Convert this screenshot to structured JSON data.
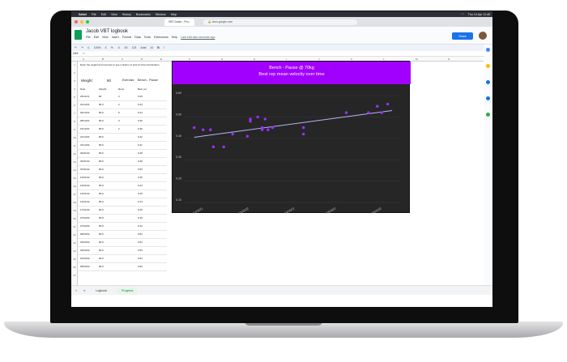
{
  "macos": {
    "app": "Safari",
    "menus": [
      "File",
      "Edit",
      "View",
      "History",
      "Bookmarks",
      "Window",
      "Help"
    ],
    "clock": "Thu 14 Apr 11:45"
  },
  "browser": {
    "tab_title": "VBT Dutch - Pro...",
    "url": "docs.google.com"
  },
  "doc": {
    "title": "Jacob VBT logbook",
    "menus": [
      "File",
      "Edit",
      "View",
      "Insert",
      "Format",
      "Data",
      "Tools",
      "Extensions",
      "Help"
    ],
    "last_edit": "Last edit was seconds ago",
    "share_label": "Share"
  },
  "toolbar": {
    "zoom": "100%",
    "format_items": [
      "£",
      "%",
      ".0",
      ".00",
      "123"
    ],
    "font": "Arial",
    "font_size": "10"
  },
  "formula_bar": {
    "cell_ref": "N48",
    "fx": "fx"
  },
  "columns": [
    "A",
    "B",
    "C",
    "D",
    "E",
    "F",
    "G",
    "H",
    "I",
    "J",
    "K",
    "L",
    "M",
    "N"
  ],
  "rows": [
    "1",
    "2",
    "3",
    "4",
    "5",
    "6",
    "7",
    "8",
    "9",
    "10",
    "11",
    "12",
    "13",
    "14",
    "15",
    "16",
    "17",
    "18",
    "19",
    "20",
    "21",
    "22",
    "23",
    "24",
    "25",
    "26",
    "27"
  ],
  "sheet": {
    "instruction": "Enter the weight and exercise to see a history of sets for that combination",
    "weight_label": "Weight:",
    "weight_value": "80",
    "exercise_label": "Exercise",
    "exercise_value": "Bench - Pause",
    "headers": [
      "Date",
      "Weight",
      "Reps",
      "Best vel"
    ],
    "table": [
      [
        "25/11/21",
        "80",
        "3",
        "0.45"
      ],
      [
        "01/12/21",
        "80.0",
        "2",
        "0.44"
      ],
      [
        "06/12/21",
        "80.0",
        "6",
        "0.44"
      ],
      [
        "08/12/21",
        "80.0",
        "3",
        "0.36"
      ],
      [
        "15/12/21",
        "80.0",
        "2",
        "0.36"
      ],
      [
        "21/12/21",
        "80.0",
        "",
        "0.42"
      ],
      [
        "31/12/21",
        "80.0",
        "",
        "0.41"
      ],
      [
        "02/01/22",
        "80.0",
        "",
        "0.48"
      ],
      [
        "02/01/22",
        "80.0",
        "",
        "0.49"
      ],
      [
        "07/01/22",
        "80.0",
        "",
        "0.50"
      ],
      [
        "10/01/22",
        "80.0",
        "",
        "0.45"
      ],
      [
        "10/01/22",
        "80.0",
        "",
        "0.44"
      ],
      [
        "12/01/22",
        "80.0",
        "",
        "0.49"
      ],
      [
        "14/01/22",
        "80.0",
        "",
        "0.44"
      ],
      [
        "17/01/22",
        "80.0",
        "",
        "0.45"
      ],
      [
        "07/02/22",
        "80.0",
        "",
        "0.45"
      ],
      [
        "07/02/22",
        "80.0",
        "",
        "0.42"
      ],
      [
        "08/03/22",
        "80.0",
        "",
        "0.52"
      ],
      [
        "23/03/22",
        "80.0",
        "",
        "0.52"
      ],
      [
        "29/03/22",
        "80.0",
        "",
        "0.55"
      ],
      [
        "01/04/22",
        "80.0",
        "",
        "0.52"
      ],
      [
        "05/04/22",
        "80.0",
        "",
        "0.56"
      ]
    ]
  },
  "chart_data": {
    "type": "scatter",
    "title": "Bench - Pause @ 70kg",
    "subtitle": "Best rep mean velocity over time",
    "colors": {
      "header": "#a100ff",
      "points": "#9b30ff",
      "trend": "#b8b4ff",
      "background": "#262626"
    },
    "yticks": [
      "0.60",
      "0.50",
      "0.40",
      "0.30",
      "0.20",
      "0.10"
    ],
    "ylim": [
      0.1,
      0.6
    ],
    "xticks": [
      "01/12/2021",
      "01/01/2022",
      "01/02/2022",
      "01/03/2022",
      "01/04/2022"
    ],
    "xlim": [
      "2021-11-18",
      "2022-04-14"
    ],
    "series": [
      {
        "points": [
          [
            "2021-11-25",
            0.45
          ],
          [
            "2021-12-01",
            0.44
          ],
          [
            "2021-12-06",
            0.44
          ],
          [
            "2021-12-08",
            0.36
          ],
          [
            "2021-12-15",
            0.36
          ],
          [
            "2021-12-21",
            0.42
          ],
          [
            "2021-12-31",
            0.41
          ],
          [
            "2022-01-02",
            0.48
          ],
          [
            "2022-01-02",
            0.49
          ],
          [
            "2022-01-07",
            0.5
          ],
          [
            "2022-01-10",
            0.45
          ],
          [
            "2022-01-10",
            0.44
          ],
          [
            "2022-01-12",
            0.49
          ],
          [
            "2022-01-14",
            0.44
          ],
          [
            "2022-01-17",
            0.45
          ],
          [
            "2022-02-07",
            0.45
          ],
          [
            "2022-02-07",
            0.42
          ],
          [
            "2022-03-08",
            0.52
          ],
          [
            "2022-03-23",
            0.52
          ],
          [
            "2022-03-29",
            0.55
          ],
          [
            "2022-04-01",
            0.52
          ],
          [
            "2022-04-05",
            0.56
          ]
        ]
      }
    ],
    "trendline": [
      [
        "2021-11-25",
        0.405
      ],
      [
        "2022-04-08",
        0.53
      ]
    ]
  },
  "sheet_tabs": {
    "add": "+",
    "all": "≡",
    "tabs": [
      "Logbook",
      "Progress"
    ],
    "active": "Progress"
  }
}
